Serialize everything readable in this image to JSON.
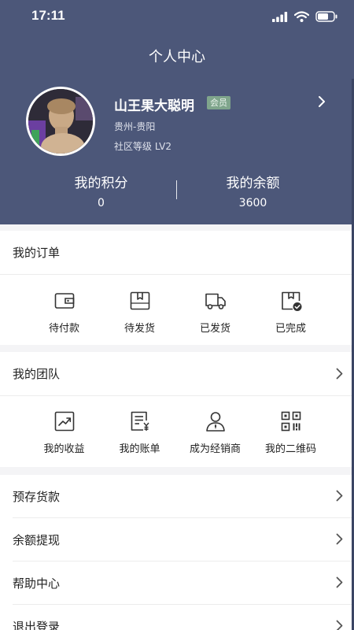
{
  "status_bar": {
    "time": "17:11"
  },
  "header": {
    "title": "个人中心"
  },
  "profile": {
    "name": "山王果大聪明",
    "badge": "会员",
    "location": "贵州-贵阳",
    "level": "社区等级 LV2"
  },
  "stats": [
    {
      "label": "我的积分",
      "value": "0"
    },
    {
      "label": "我的余额",
      "value": "3600"
    }
  ],
  "orders": {
    "title": "我的订单",
    "items": [
      {
        "label": "待付款",
        "icon": "wallet-icon"
      },
      {
        "label": "待发货",
        "icon": "package-icon"
      },
      {
        "label": "已发货",
        "icon": "truck-icon"
      },
      {
        "label": "已完成",
        "icon": "completed-box-icon"
      }
    ]
  },
  "team": {
    "title": "我的团队",
    "items": [
      {
        "label": "我的收益",
        "icon": "trend-chart-icon"
      },
      {
        "label": "我的账单",
        "icon": "bill-icon"
      },
      {
        "label": "成为经销商",
        "icon": "person-icon"
      },
      {
        "label": "我的二维码",
        "icon": "qrcode-icon"
      }
    ]
  },
  "menu": [
    {
      "label": "预存货款"
    },
    {
      "label": "余额提现"
    },
    {
      "label": "帮助中心"
    },
    {
      "label": "退出登录"
    }
  ],
  "colors": {
    "header_bg": "#4c5779",
    "badge_bg": "#7fa58c",
    "page_bg": "#f4f4f6"
  }
}
